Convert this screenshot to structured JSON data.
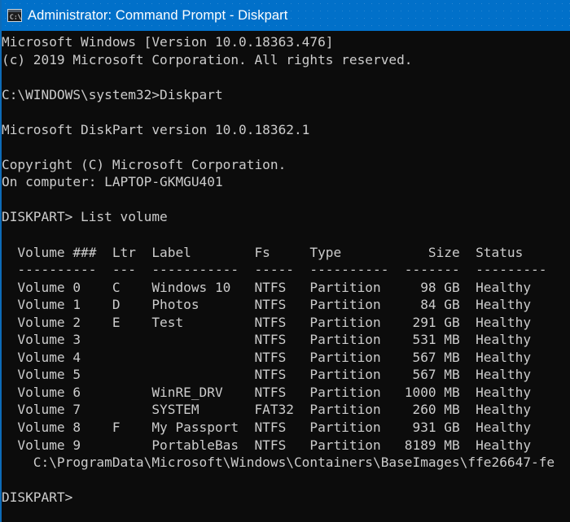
{
  "window": {
    "title": "Administrator: Command Prompt - Diskpart",
    "icon": "command-prompt-icon",
    "icon_label": "C:\\",
    "titlebar_color": "#0170c9",
    "console_background": "#0c0c0c",
    "console_foreground": "#cccccc"
  },
  "terminal": {
    "banner": [
      "Microsoft Windows [Version 10.0.18363.476]",
      "(c) 2019 Microsoft Corporation. All rights reserved."
    ],
    "prompt_line": "C:\\WINDOWS\\system32>Diskpart",
    "diskpart_version": "Microsoft DiskPart version 10.0.18362.1",
    "copyright": "Copyright (C) Microsoft Corporation.",
    "computer_line": "On computer: LAPTOP-GKMGU401",
    "command_line": "DISKPART> List volume",
    "table": {
      "headers": [
        "Volume ###",
        "Ltr",
        "Label",
        "Fs",
        "Type",
        "Size",
        "Status"
      ],
      "separator": [
        "----------",
        "---",
        "-----------",
        "-----",
        "----------",
        "-------",
        "---------"
      ],
      "rows": [
        {
          "volume": "Volume 0",
          "ltr": "C",
          "label": "Windows 10",
          "fs": "NTFS",
          "type": "Partition",
          "size": "98 GB",
          "status": "Healthy"
        },
        {
          "volume": "Volume 1",
          "ltr": "D",
          "label": "Photos",
          "fs": "NTFS",
          "type": "Partition",
          "size": "84 GB",
          "status": "Healthy"
        },
        {
          "volume": "Volume 2",
          "ltr": "E",
          "label": "Test",
          "fs": "NTFS",
          "type": "Partition",
          "size": "291 GB",
          "status": "Healthy"
        },
        {
          "volume": "Volume 3",
          "ltr": "",
          "label": "",
          "fs": "NTFS",
          "type": "Partition",
          "size": "531 MB",
          "status": "Healthy"
        },
        {
          "volume": "Volume 4",
          "ltr": "",
          "label": "",
          "fs": "NTFS",
          "type": "Partition",
          "size": "567 MB",
          "status": "Healthy"
        },
        {
          "volume": "Volume 5",
          "ltr": "",
          "label": "",
          "fs": "NTFS",
          "type": "Partition",
          "size": "567 MB",
          "status": "Healthy"
        },
        {
          "volume": "Volume 6",
          "ltr": "",
          "label": "WinRE_DRV",
          "fs": "NTFS",
          "type": "Partition",
          "size": "1000 MB",
          "status": "Healthy"
        },
        {
          "volume": "Volume 7",
          "ltr": "",
          "label": "SYSTEM",
          "fs": "FAT32",
          "type": "Partition",
          "size": "260 MB",
          "status": "Healthy"
        },
        {
          "volume": "Volume 8",
          "ltr": "F",
          "label": "My Passport",
          "fs": "NTFS",
          "type": "Partition",
          "size": "931 GB",
          "status": "Healthy"
        },
        {
          "volume": "Volume 9",
          "ltr": "",
          "label": "PortableBas",
          "fs": "NTFS",
          "type": "Partition",
          "size": "8189 MB",
          "status": "Healthy"
        }
      ]
    },
    "mount_path_line": "    C:\\ProgramData\\Microsoft\\Windows\\Containers\\BaseImages\\ffe26647-fe",
    "final_prompt": "DISKPART>"
  }
}
